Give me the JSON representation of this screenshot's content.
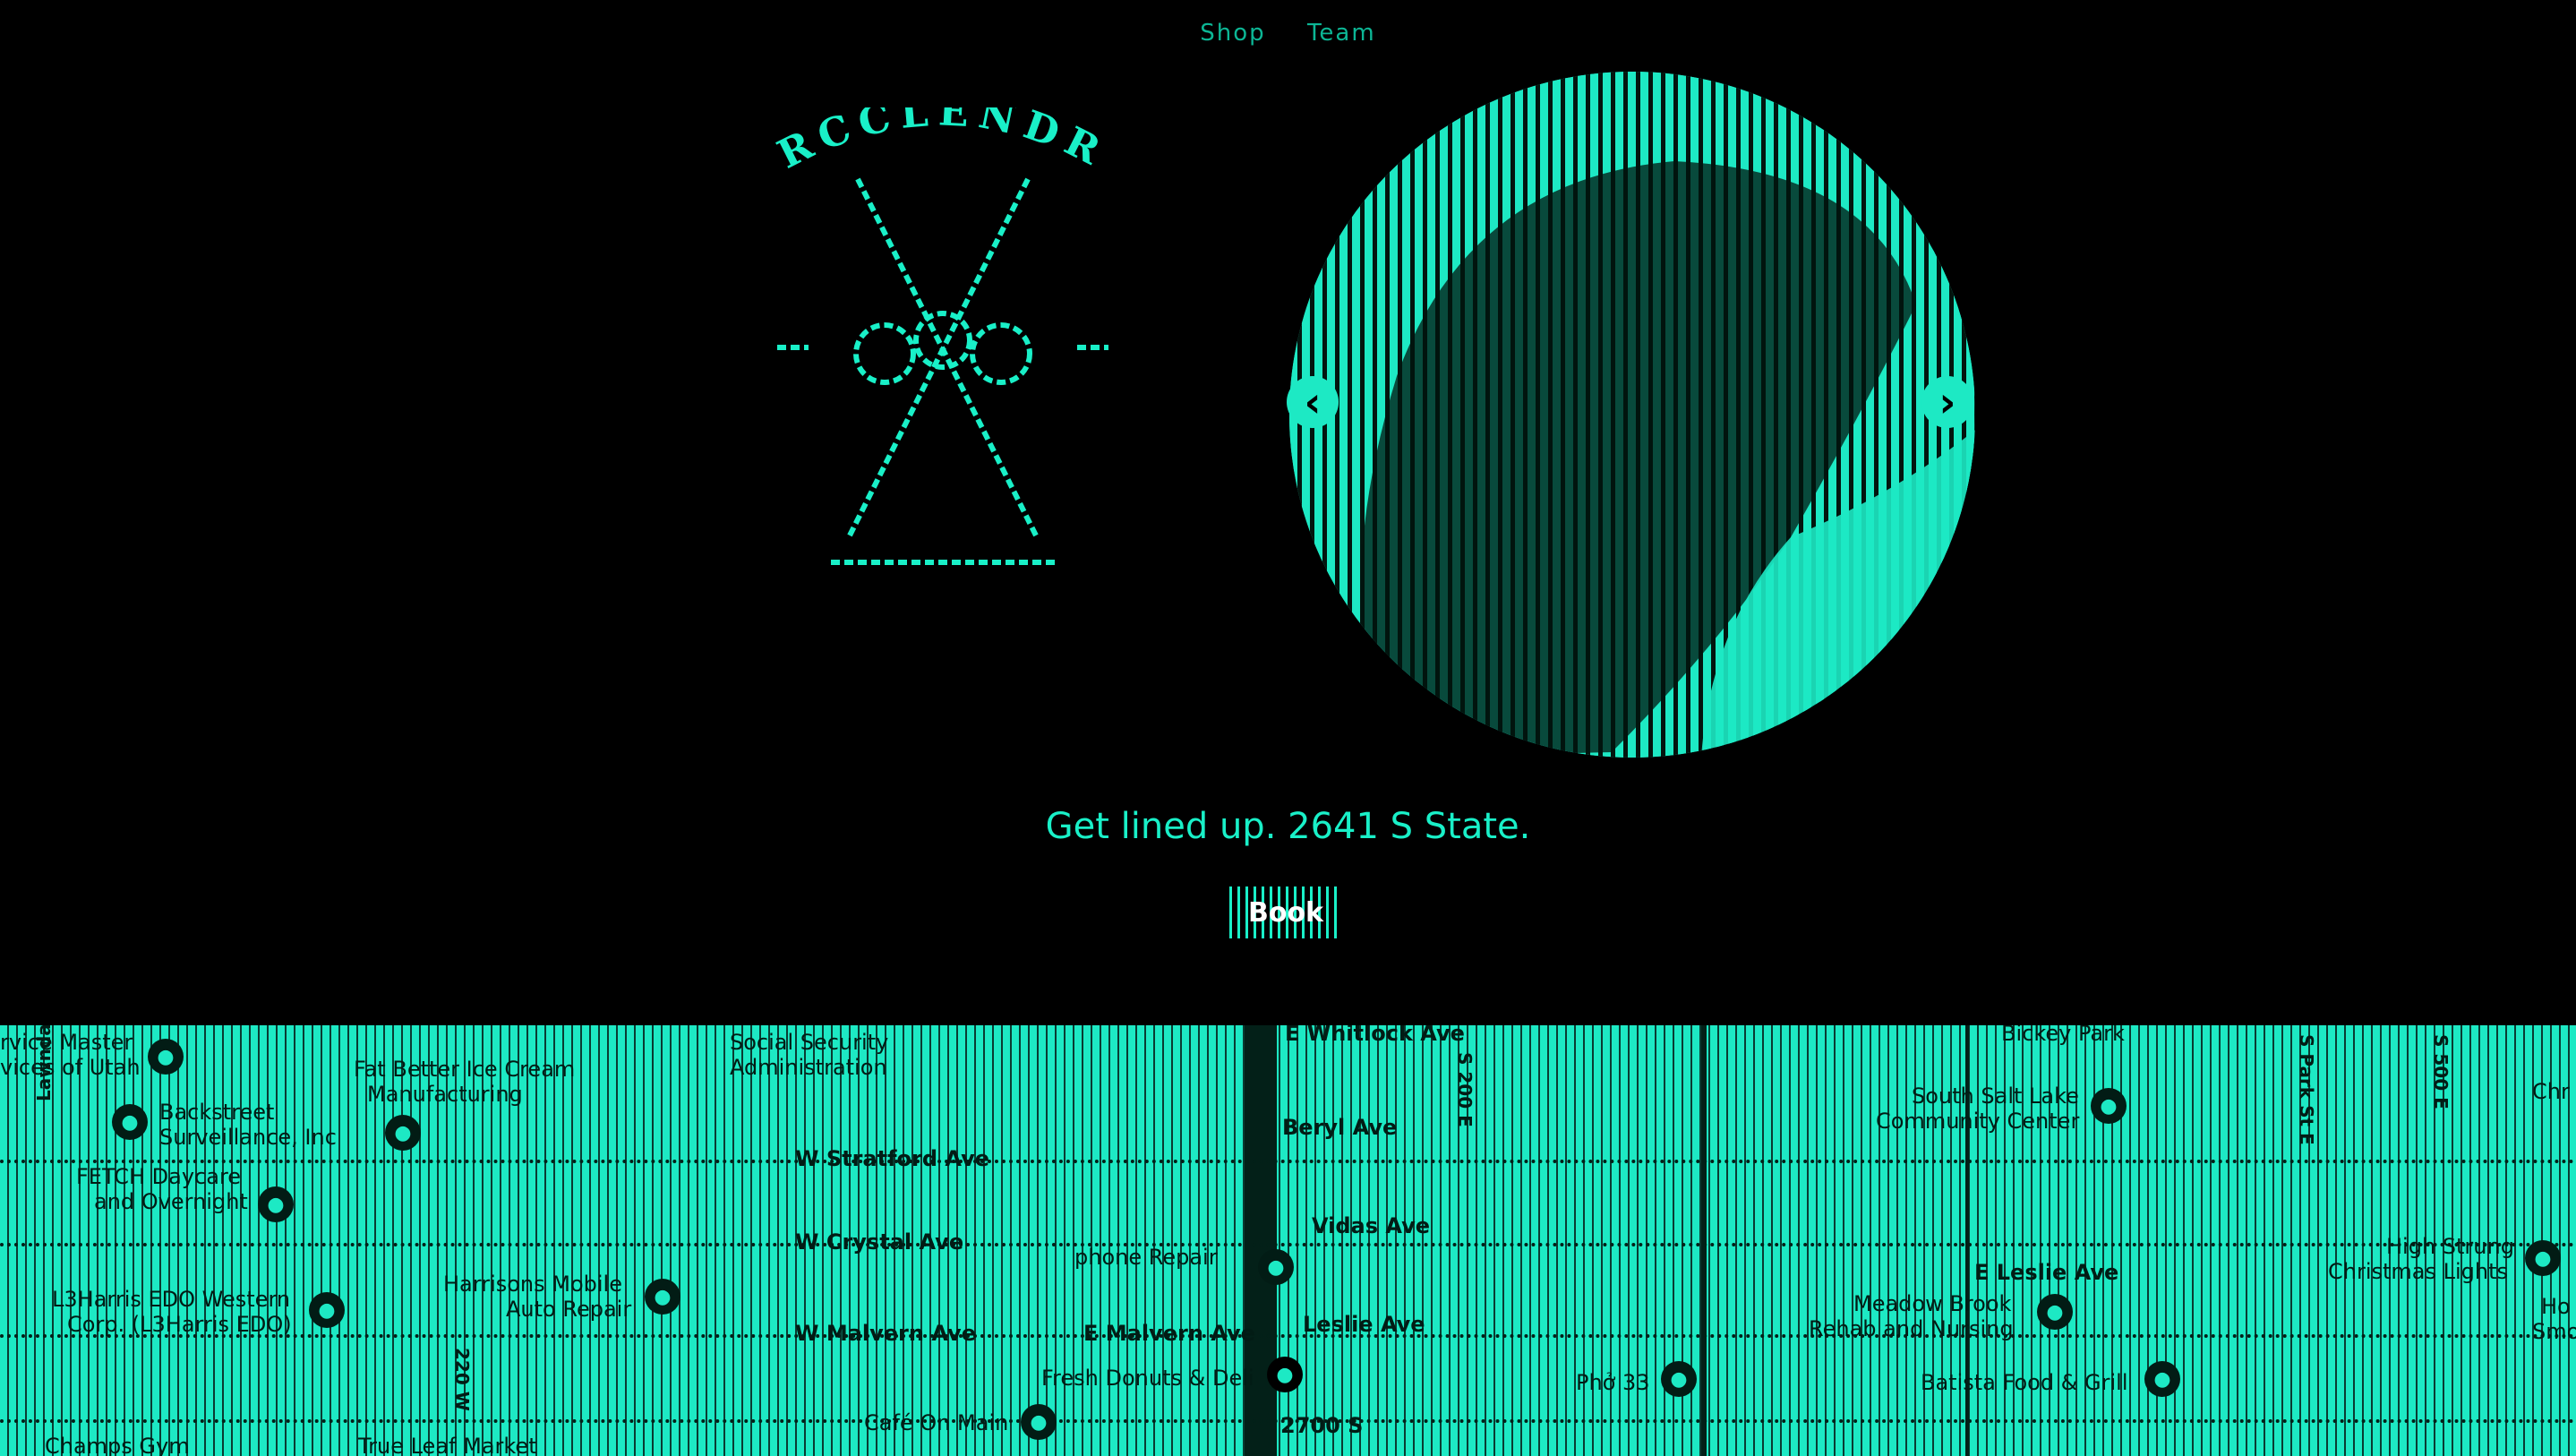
{
  "nav": {
    "items": [
      "Shop",
      "Team"
    ]
  },
  "logo": {
    "text": "RCCLENDR"
  },
  "hero": {
    "tagline": "Get lined up. 2641 S State.",
    "book_label": "Book",
    "prev_label": "‹",
    "next_label": "›"
  },
  "map": {
    "labels": [
      "rvice Master",
      "vices of Utah",
      "Backstreet",
      "Surveillance, Inc",
      "FETCH Daycare",
      "and Overnight",
      "L3Harris EDO Western",
      "Corp. (L3Harris EDO)",
      "Fat Better Ice Cream",
      "Manufacturing",
      "Harrisons Mobile",
      "Auto Repair",
      "Social Security",
      "Administration",
      "W Stratford Ave",
      "W Crystal Ave",
      "W Malvern Ave",
      "Café On Main",
      "phone Repair",
      "E Malvern Ave",
      "Fresh Donuts & Deli",
      "E Whitlock Ave",
      "Beryl Ave",
      "Vidas Ave",
      "Leslie Ave",
      "2700 S",
      "Phở 33",
      "Bickey Park",
      "South Salt Lake",
      "Community Center",
      "E Leslie Ave",
      "Meadow Brook",
      "Rehab and Nursing",
      "Batista Food & Grill",
      "High Strung",
      "Christmas Lights",
      "Champs Gym",
      "True Leaf Market",
      "Lawndale Dr",
      "S 200 E",
      "S Park St E",
      "S 500 E",
      "220 W",
      "Chr",
      "Ho",
      "Smo"
    ]
  }
}
